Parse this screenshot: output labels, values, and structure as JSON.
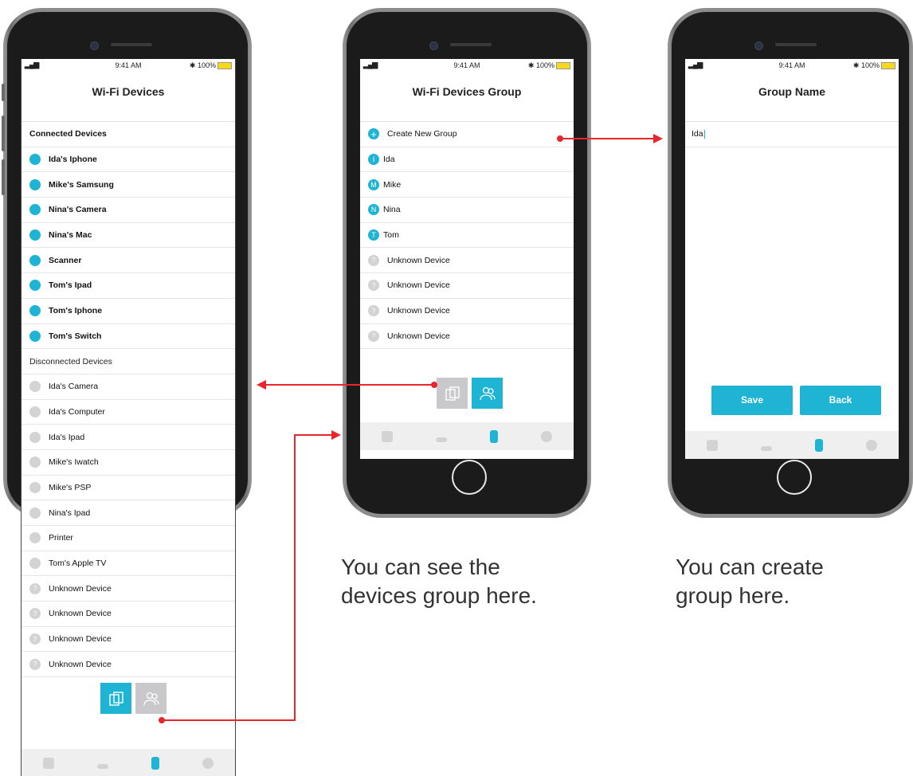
{
  "status": {
    "time": "9:41 AM",
    "battery": "100%",
    "signal": "▂▄▆"
  },
  "screen1": {
    "title": "Wi-Fi Devices",
    "connected_header": "Connected Devices",
    "connected": [
      "Ida's Iphone",
      "Mike's Samsung",
      "Nina's Camera",
      "Nina's Mac",
      "Scanner",
      "Tom's Ipad",
      "Tom's Iphone",
      "Tom's Switch"
    ],
    "disconnected_header": "Disconnected Devices",
    "disconnected": [
      "Ida's Camera",
      "Ida's Computer",
      "Ida's Ipad",
      "Mike's Iwatch",
      "Mike's PSP",
      "Nina's Ipad",
      "Printer",
      "Tom's Apple TV",
      "Unknown Device",
      "Unknown Device",
      "Unknown Device",
      "Unknown Device"
    ]
  },
  "screen2": {
    "title": "Wi-Fi Devices Group",
    "create_label": "Create New Group",
    "groups": [
      {
        "initial": "I",
        "name": "Ida"
      },
      {
        "initial": "M",
        "name": "Mike"
      },
      {
        "initial": "N",
        "name": "Nina"
      },
      {
        "initial": "T",
        "name": "Tom"
      }
    ],
    "unknown": [
      "Unknown Device",
      "Unknown Device",
      "Unknown Device",
      "Unknown Device"
    ],
    "caption_line1": "You can see the",
    "caption_line2": "devices group here."
  },
  "screen3": {
    "title": "Group Name",
    "input_value": "Ida",
    "save_label": "Save",
    "back_label": "Back",
    "caption_line1": "You can create",
    "caption_line2": "group here."
  },
  "colors": {
    "accent": "#1fb4d4",
    "arrow": "#e8262d",
    "inactive": "#d3d3d3"
  },
  "icons": {
    "create": "plus-icon",
    "unknown": "question-icon",
    "device_view": "device-list-icon",
    "group_view": "people-group-icon"
  },
  "tab_icons": [
    "camera-icon",
    "router-icon",
    "phone-icon",
    "gear-icon"
  ]
}
